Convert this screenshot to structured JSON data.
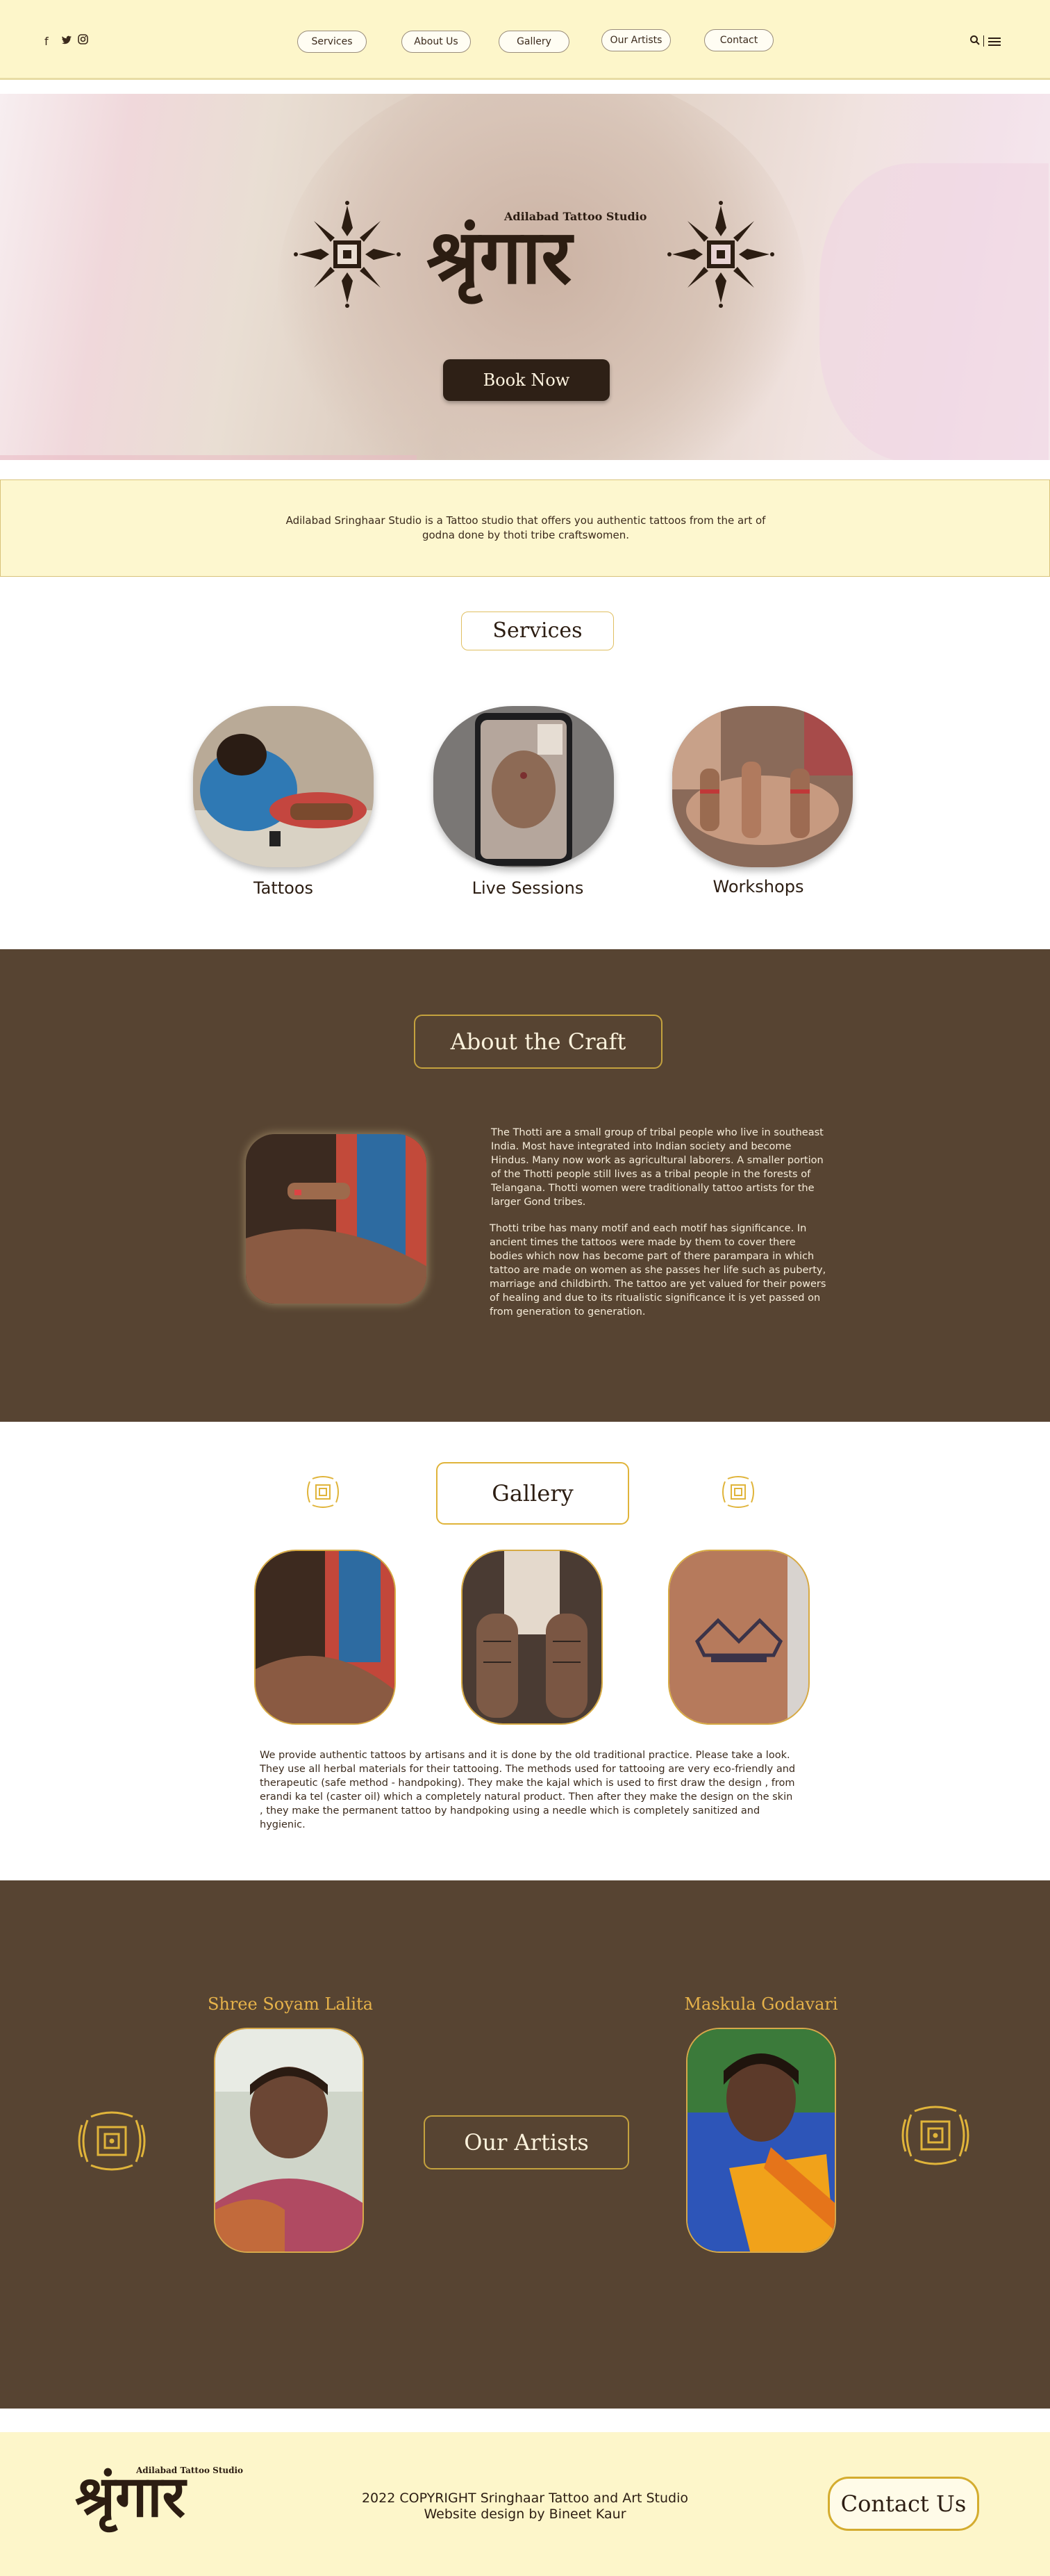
{
  "nav": {
    "social": [
      "f",
      "•",
      "◎"
    ],
    "items": [
      "Services",
      "About Us",
      "Gallery",
      "Our Artists",
      "Contact"
    ],
    "icons": [
      "search-icon",
      "menu-icon"
    ]
  },
  "hero": {
    "logo_text": "श्रृंगार",
    "logo_subtitle": "Adilabad Tattoo Studio",
    "book_label": "Book Now"
  },
  "intro": {
    "text": "Adilabad Sringhaar Studio is a Tattoo studio that offers you authentic tattoos from the art of godna done by thoti tribe craftswomen."
  },
  "services": {
    "title": "Services",
    "items": [
      {
        "label": "Tattoos"
      },
      {
        "label": "Live Sessions"
      },
      {
        "label": "Workshops"
      }
    ]
  },
  "about": {
    "title": "About the Craft",
    "paragraphs": [
      "The Thotti are a small group of tribal people who live in southeast India. Most have integrated into Indian society and become Hindus. Many now work as agricultural laborers. A smaller portion of the Thotti people still lives as a tribal people in the forests of Telangana. Thotti women were traditionally tattoo artists for the larger Gond tribes.",
      "Thotti tribe has many motif  and each motif has significance. In ancient times the tattoos were made by them to cover there bodies which now has become part of there parampara in which tattoo are made on women as she passes her life such as puberty, marriage and childbirth. The tattoo are yet valued for their powers of healing and due to its ritualistic significance it is yet passed on from generation to generation."
    ]
  },
  "gallery": {
    "title": "Gallery",
    "text": "We provide authentic tattoos by artisans and it is done by the old traditional practice. Please take a look. They use all herbal materials for their tattooing. The methods used for tattooing are very eco-friendly and therapeutic (safe method - handpoking). They make the kajal which is used to first draw the design , from erandi ka tel (caster oil) which a completely natural product. Then after they make the design on the skin , they make the permanent tattoo by handpoking using a needle which is completely sanitized and hygienic."
  },
  "artists": {
    "title": "Our Artists",
    "items": [
      {
        "name": "Shree Soyam Lalita"
      },
      {
        "name": "Maskula Godavari"
      }
    ]
  },
  "footer": {
    "logo_text": "श्रृंगार",
    "logo_subtitle": "Adilabad Tattoo Studio",
    "copyright": "2022 COPYRIGHT Sringhaar Tattoo and Art Studio",
    "credit": "Website design by Bineet Kaur",
    "contact_label": "Contact Us"
  },
  "colors": {
    "cream": "#fdf6ca",
    "brown": "#574432",
    "gold": "#e0b43a",
    "dark": "#2c1d12"
  }
}
